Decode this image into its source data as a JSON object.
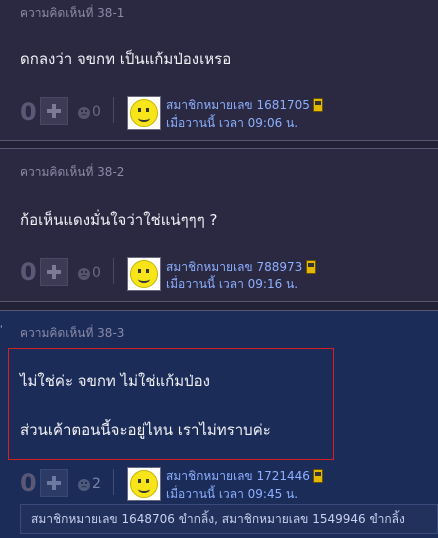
{
  "comments": [
    {
      "header": "ความคิดเห็นที่ 38-1",
      "lines": [
        "ดกลงว่า จขกท เป็นแก้มป่องเหรอ"
      ],
      "score": "0",
      "sad_count": "0",
      "member": "สมาชิกหมายเลข 1681705",
      "time": "เมื่อวานนี้ เวลา 09:06 น."
    },
    {
      "header": "ความคิดเห็นที่ 38-2",
      "lines": [
        "ก้อเห็นแดงมั่นใจว่าใช่แน่ๆๆๆ ?"
      ],
      "score": "0",
      "sad_count": "0",
      "member": "สมาชิกหมายเลข 788973",
      "time": "เมื่อวานนี้ เวลา 09:16 น."
    },
    {
      "header": "ความคิดเห็นที่ 38-3",
      "lines": [
        "ไม่ใช่ค่ะ จขกท ไม่ใช่แก้มป่อง",
        "ส่วนเค้าตอนนี้จะอยู่ไหน เราไม่ทราบค่ะ"
      ],
      "score": "0",
      "sad_count": "2",
      "member": "สมาชิกหมายเลข 1721446",
      "time": "เมื่อวานนี้ เวลา 09:45 น.",
      "reactions": "สมาชิกหมายเลข 1648706 ขำกลิ้ง, สมาชิกหมายเลข 1549946 ขำกลิ้ง"
    }
  ],
  "icons": {
    "plus": "plus-icon",
    "sad": "sad-face-icon",
    "avatar": "smiley-avatar",
    "mobile": "mobile-phone-icon"
  },
  "colors": {
    "background": "#232136",
    "highlight_comment_bg": "#1c2c59",
    "link_blue": "#8cb0ff",
    "highlight_border": "#d42020"
  }
}
